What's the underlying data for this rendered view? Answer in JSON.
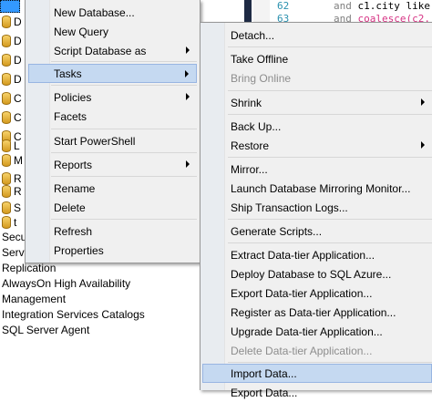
{
  "editor": {
    "lines": [
      {
        "num": "62",
        "code": [
          "and ",
          "c1.city like"
        ]
      },
      {
        "num": "63",
        "code": [
          "and ",
          "coalesce(c2."
        ]
      }
    ]
  },
  "tree": {
    "db_letters": [
      "D",
      "D",
      "D",
      "D",
      "C",
      "C",
      "C",
      "L",
      "M",
      "R",
      "R",
      "S",
      "t"
    ],
    "nodes": [
      "Secu",
      "Serve",
      "Replication",
      "AlwaysOn High Availability",
      "Management",
      "Integration Services Catalogs",
      "SQL Server Agent"
    ]
  },
  "menu1": {
    "items": [
      {
        "label": "New Database...",
        "submenu": false
      },
      {
        "label": "New Query",
        "submenu": false
      },
      {
        "label": "Script Database as",
        "submenu": true
      },
      {
        "label": "Tasks",
        "submenu": true,
        "highlighted": true
      },
      {
        "label": "Policies",
        "submenu": true
      },
      {
        "label": "Facets",
        "submenu": false
      },
      {
        "label": "Start PowerShell",
        "submenu": false
      },
      {
        "label": "Reports",
        "submenu": true
      },
      {
        "label": "Rename",
        "submenu": false
      },
      {
        "label": "Delete",
        "submenu": false
      },
      {
        "label": "Refresh",
        "submenu": false
      },
      {
        "label": "Properties",
        "submenu": false
      }
    ]
  },
  "menu2": {
    "items": [
      {
        "label": "Detach...",
        "submenu": false
      },
      {
        "label": "Take Offline",
        "submenu": false
      },
      {
        "label": "Bring Online",
        "submenu": false,
        "disabled": true
      },
      {
        "label": "Shrink",
        "submenu": true
      },
      {
        "label": "Back Up...",
        "submenu": false
      },
      {
        "label": "Restore",
        "submenu": true
      },
      {
        "label": "Mirror...",
        "submenu": false
      },
      {
        "label": "Launch Database Mirroring Monitor...",
        "submenu": false
      },
      {
        "label": "Ship Transaction Logs...",
        "submenu": false
      },
      {
        "label": "Generate Scripts...",
        "submenu": false
      },
      {
        "label": "Extract Data-tier Application...",
        "submenu": false
      },
      {
        "label": "Deploy Database to SQL Azure...",
        "submenu": false
      },
      {
        "label": "Export Data-tier Application...",
        "submenu": false
      },
      {
        "label": "Register as Data-tier Application...",
        "submenu": false
      },
      {
        "label": "Upgrade Data-tier Application...",
        "submenu": false
      },
      {
        "label": "Delete Data-tier Application...",
        "submenu": false,
        "disabled": true
      },
      {
        "label": "Import Data...",
        "submenu": false,
        "highlighted": true
      },
      {
        "label": "Export Data...",
        "submenu": false
      }
    ]
  }
}
